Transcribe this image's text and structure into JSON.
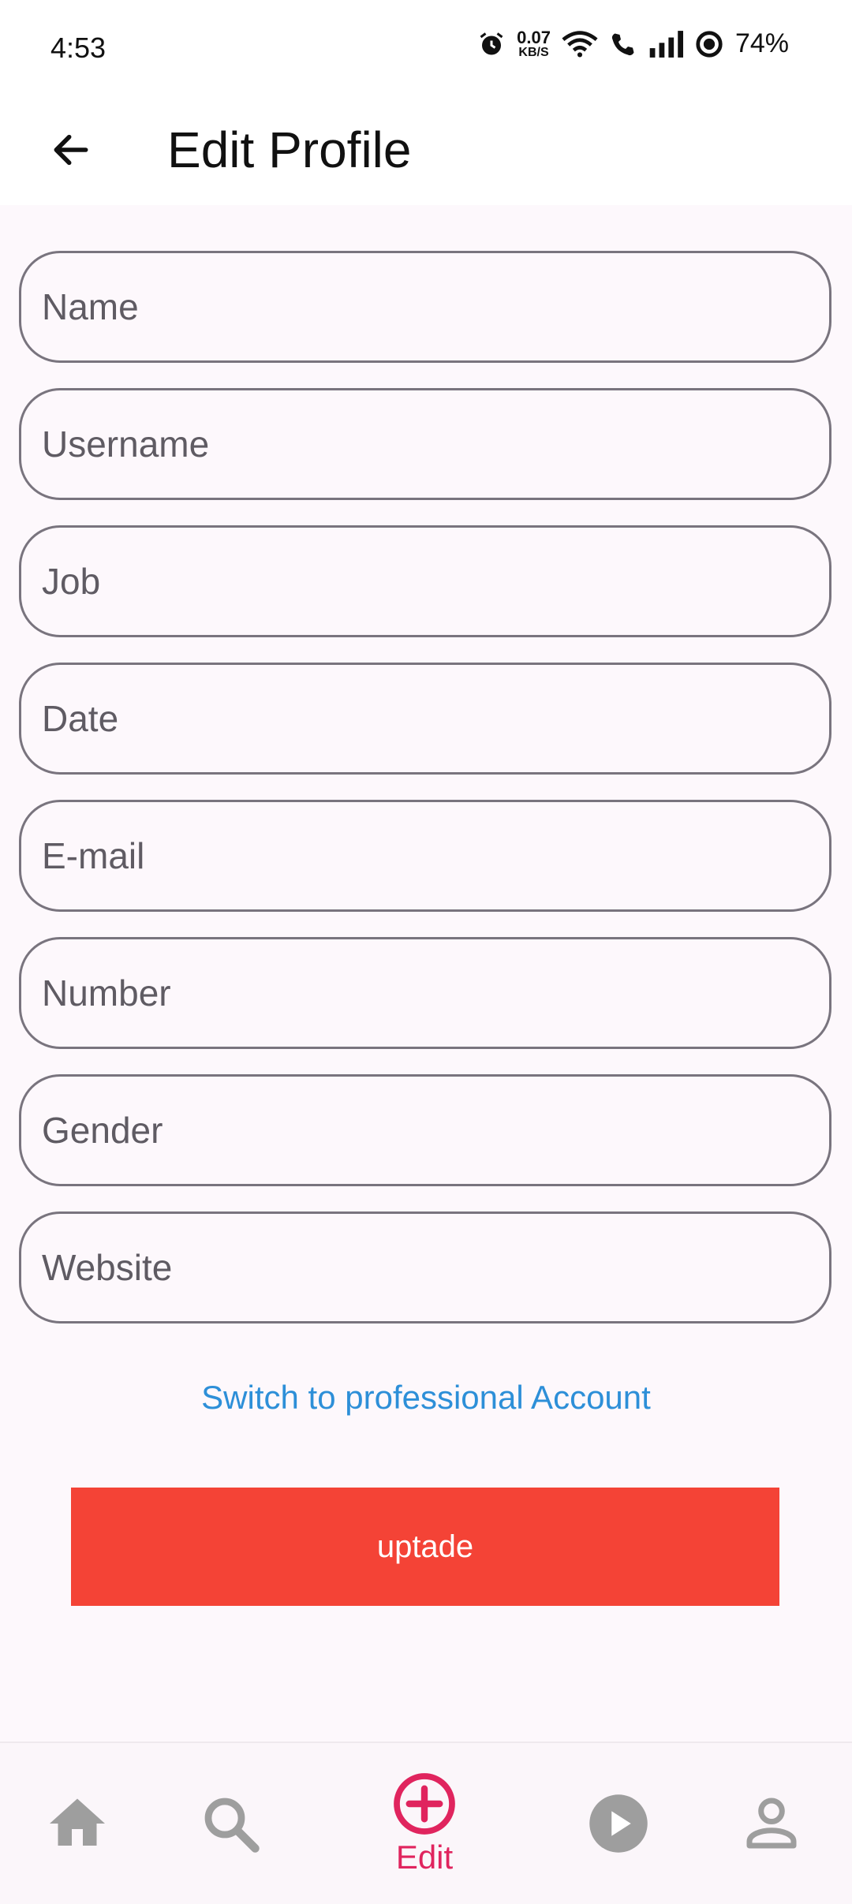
{
  "status_bar": {
    "time": "4:53",
    "net_speed_value": "0.07",
    "net_speed_unit": "KB/S",
    "battery": "74%"
  },
  "app_bar": {
    "title": "Edit Profile",
    "back_icon": "arrow-left-icon"
  },
  "form": {
    "fields": [
      {
        "placeholder": "Name",
        "value": ""
      },
      {
        "placeholder": "Username",
        "value": ""
      },
      {
        "placeholder": "Job",
        "value": ""
      },
      {
        "placeholder": "Date",
        "value": ""
      },
      {
        "placeholder": "E-mail",
        "value": ""
      },
      {
        "placeholder": "Number",
        "value": ""
      },
      {
        "placeholder": "Gender",
        "value": ""
      },
      {
        "placeholder": "Website",
        "value": ""
      }
    ],
    "switch_link": "Switch to professional Account",
    "update_label": "uptade"
  },
  "bottom_nav": {
    "items": [
      {
        "icon": "home-icon",
        "label": ""
      },
      {
        "icon": "search-icon",
        "label": ""
      },
      {
        "icon": "add-circle-icon",
        "label": "Edit",
        "active": true
      },
      {
        "icon": "play-icon",
        "label": ""
      },
      {
        "icon": "person-icon",
        "label": ""
      }
    ]
  },
  "colors": {
    "accent": "#e0245e",
    "link": "#2d8fd8",
    "button": "#f44336",
    "icon_inactive": "#9e9e9e"
  }
}
